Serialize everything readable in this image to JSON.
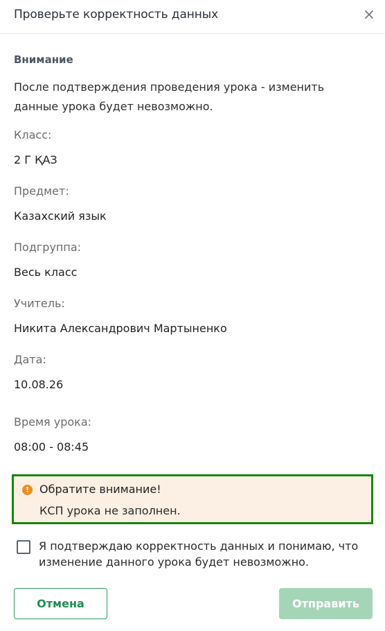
{
  "dialog": {
    "title": "Проверьте корректность данных",
    "close_icon": "close-icon"
  },
  "warning": {
    "title": "Внимание",
    "text": "После подтверждения проведения урока - изменить данные урока будет невозможно."
  },
  "fields": [
    {
      "label": "Класс:",
      "value": "2 Г ҚАЗ"
    },
    {
      "label": "Предмет:",
      "value": "Казахский язык"
    },
    {
      "label": "Подгруппа:",
      "value": "Весь класс"
    },
    {
      "label": "Учитель:",
      "value": "Никита Александрович Мартыненко"
    },
    {
      "label": "Дата:",
      "value": "10.08.26"
    },
    {
      "label": "Время урока:",
      "value": "08:00 - 08:45"
    }
  ],
  "notice": {
    "icon": "info-icon",
    "icon_glyph": "!",
    "title": "Обратите внимание!",
    "text": "КСП урока не заполнен.",
    "background_color": "#fcefe3",
    "border_color": "#11880f"
  },
  "confirmation": {
    "checked": false,
    "label": "Я подтверждаю корректность данных и понимаю, что изменение данного урока будет невозможно."
  },
  "buttons": {
    "cancel_label": "Отмена",
    "submit_label": "Отправить",
    "submit_enabled": false,
    "accent_color": "#1f8f52",
    "disabled_color": "#a5d5b7"
  }
}
